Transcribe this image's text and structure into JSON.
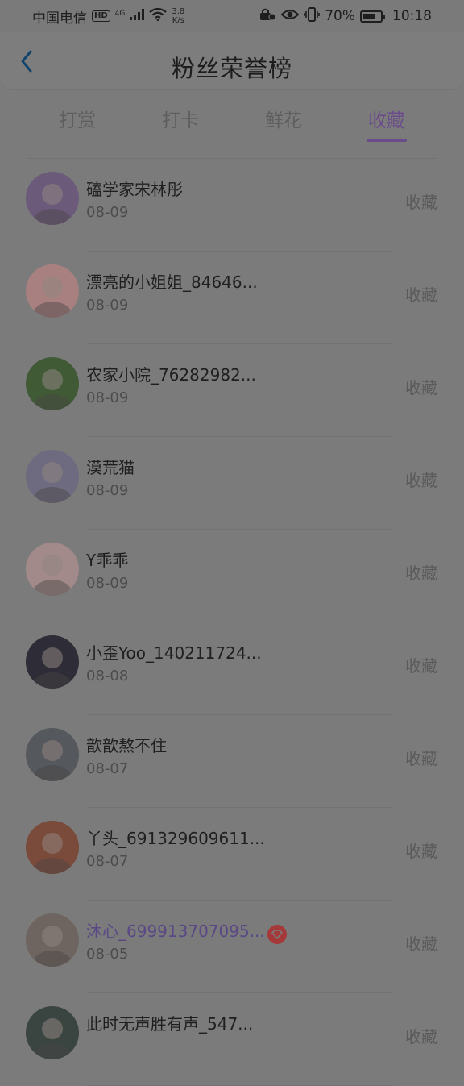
{
  "status_bar": {
    "carrier": "中国电信",
    "hd": "HD",
    "network": "4G",
    "speed_value": "3.8",
    "speed_unit": "K/s",
    "battery": "70%",
    "battery_level": 0.7,
    "time": "10:18"
  },
  "header": {
    "title": "粉丝荣誉榜"
  },
  "tabs": [
    {
      "label": "打赏"
    },
    {
      "label": "打卡"
    },
    {
      "label": "鲜花"
    },
    {
      "label": "收藏"
    }
  ],
  "active_tab": "收藏",
  "rows": [
    {
      "name": "磕学家宋林彤",
      "date": "08-09",
      "action": "收藏",
      "avatar_color": "#6b5a7a"
    },
    {
      "name": "漂亮的小姐姐_84646...",
      "date": "08-09",
      "action": "收藏",
      "avatar_color": "#a88080"
    },
    {
      "name": "农家小院_76282982...",
      "date": "08-09",
      "action": "收藏",
      "avatar_color": "#3f5a35"
    },
    {
      "name": "漠荒猫",
      "date": "08-09",
      "action": "收藏",
      "avatar_color": "#6e6a80"
    },
    {
      "name": "Y乖乖",
      "date": "08-09",
      "action": "收藏",
      "avatar_color": "#a28a8a"
    },
    {
      "name": "小歪Yoo_140211724...",
      "date": "08-08",
      "action": "收藏",
      "avatar_color": "#2e2c36"
    },
    {
      "name": "歆歆熬不住",
      "date": "08-07",
      "action": "收藏",
      "avatar_color": "#55585c"
    },
    {
      "name": "丫头_691329609611...",
      "date": "08-07",
      "action": "收藏",
      "avatar_color": "#7a4a3a"
    },
    {
      "name": "沐心_699913707095...",
      "date": "08-05",
      "action": "收藏",
      "avatar_color": "#6e6560",
      "vip": true
    },
    {
      "name": "此时无声胜有声_547...",
      "date": "",
      "action": "收藏",
      "avatar_color": "#3a4440"
    }
  ],
  "colors": {
    "accent": "#6a4c8a",
    "vip_badge": "#a53838"
  }
}
